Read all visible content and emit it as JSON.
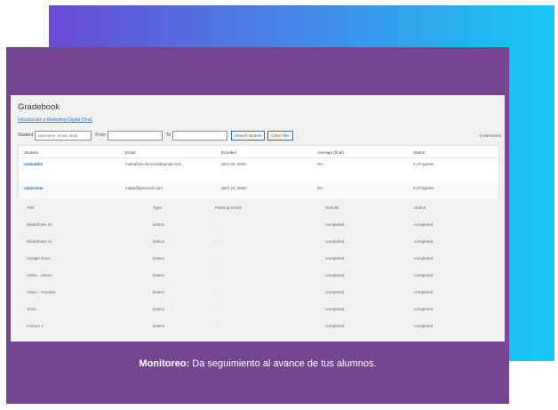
{
  "gradebook": {
    "title": "Gradebook",
    "course_link": "Introducción a Marketing Digital (Test)",
    "filter": {
      "student_label": "Student",
      "student_placeholder": "username, email, displ",
      "from_label": "From",
      "to_label": "To",
      "search_button": "Search student",
      "clear_button": "Clear filter",
      "count": "5 elementos"
    }
  },
  "students": {
    "headers": [
      "Student",
      "Email",
      "Enrolled",
      "Average (final)",
      "Status"
    ],
    "rows": [
      {
        "student": "malvaldi6",
        "email": "malval16+demo16@gmail.com",
        "enrolled": "abril 16, 2020",
        "average": "0%",
        "status": "In Progress"
      },
      {
        "student": "Jalan Doe",
        "email": "maka@peruvnil.com",
        "enrolled": "abril 16, 2020",
        "average": "0%",
        "status": "In Progress"
      }
    ]
  },
  "lessons": {
    "headers": [
      "Title",
      "Type",
      "Passing Grade",
      "Results",
      "Status"
    ],
    "rows": [
      {
        "title": "SlideShare 01",
        "type": "lesson",
        "passing": "-",
        "results": "completed",
        "status": "completed"
      },
      {
        "title": "SlideShare 02",
        "type": "lesson",
        "passing": "-",
        "results": "completed",
        "status": "completed"
      },
      {
        "title": "Google Docs",
        "type": "lesson",
        "passing": "-",
        "results": "completed",
        "status": "completed"
      },
      {
        "title": "Video - Vimeo",
        "type": "lesson",
        "passing": "-",
        "results": "completed",
        "status": "completed"
      },
      {
        "title": "Video - Youtube",
        "type": "lesson",
        "passing": "-",
        "results": "completed",
        "status": "completed"
      },
      {
        "title": "Texto",
        "type": "lesson",
        "passing": "-",
        "results": "completed",
        "status": "completed"
      },
      {
        "title": "Lesson 1",
        "type": "lesson",
        "passing": "-",
        "results": "completed",
        "status": "completed"
      }
    ]
  },
  "caption": {
    "bold": "Monitoreo:",
    "text": " Da seguimiento al avance de tus alumnos."
  },
  "colors": {
    "card_purple": "#74468f",
    "gradient_start": "#6a4bd6",
    "gradient_end": "#17c8f5",
    "link_blue": "#2a6fb0"
  }
}
